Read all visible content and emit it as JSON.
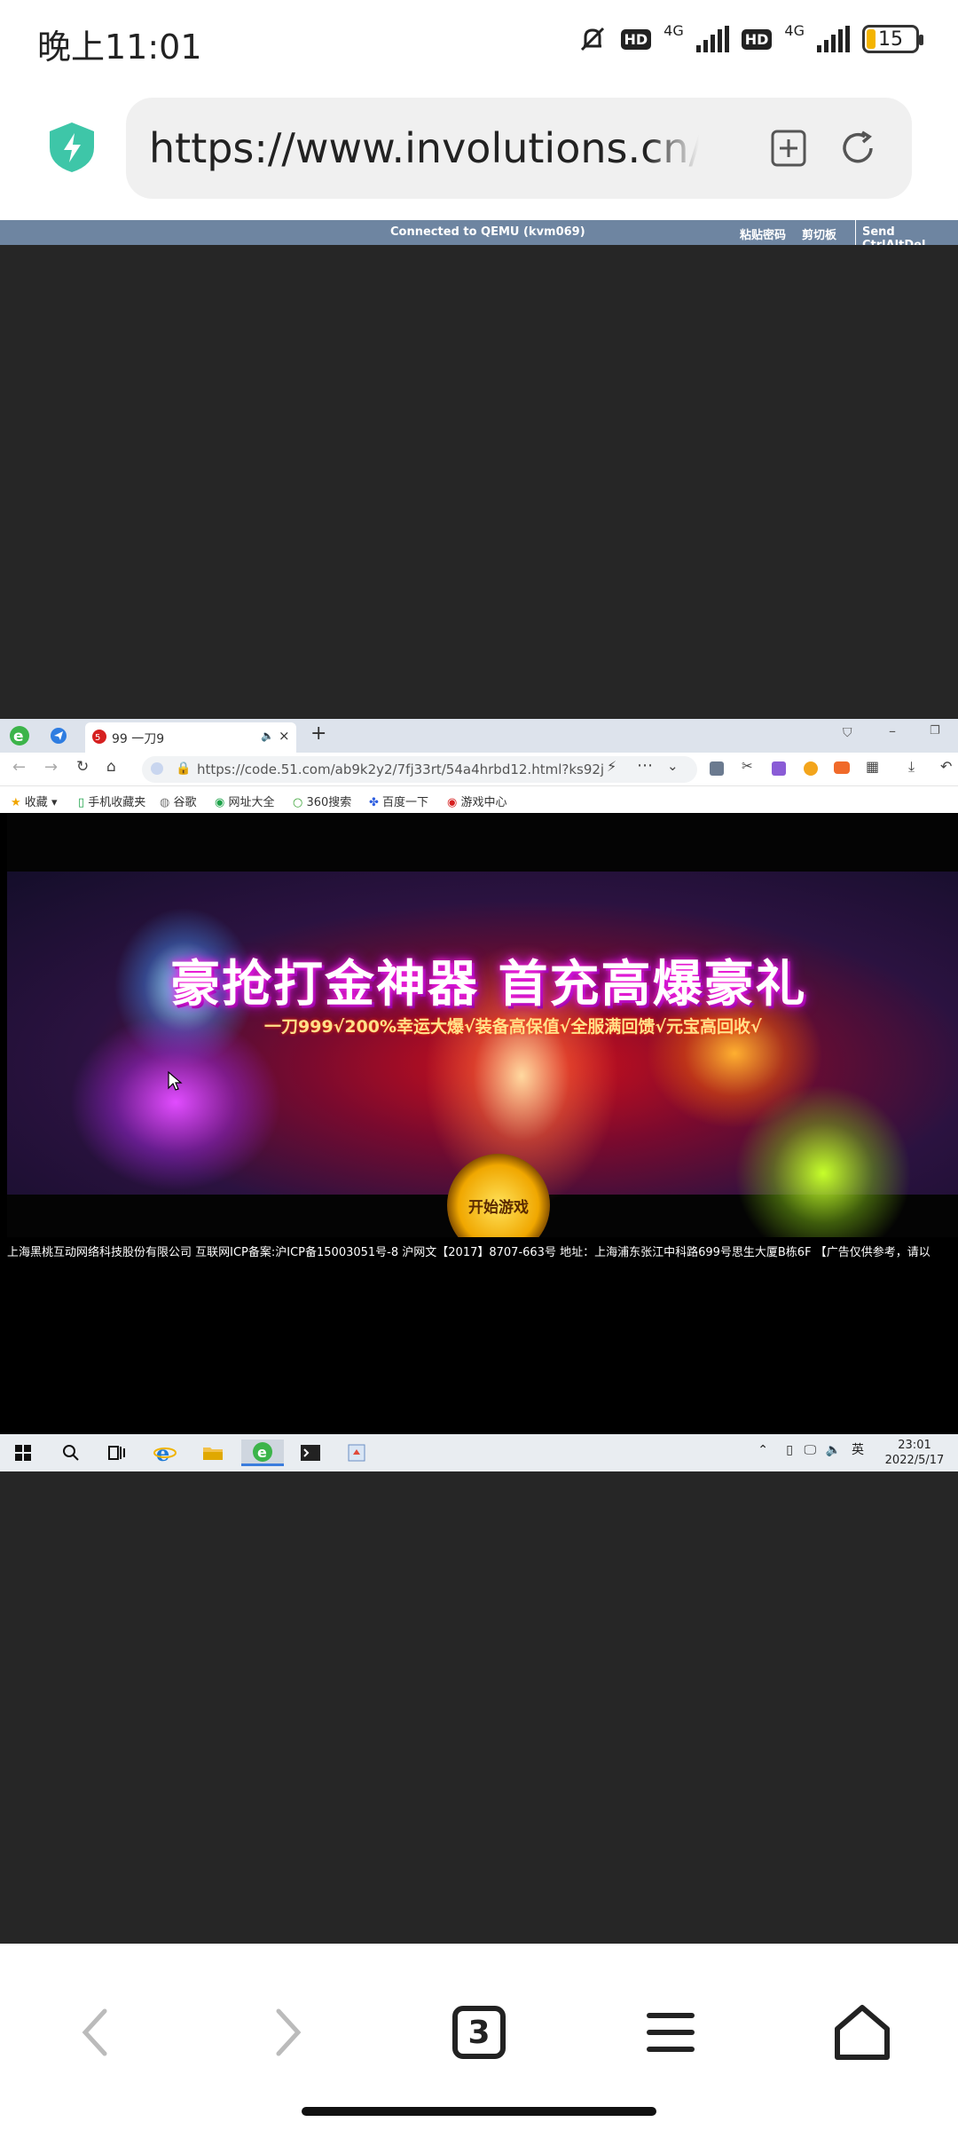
{
  "status_bar": {
    "time": "晚上11:01",
    "hd1": "HD",
    "net1": "4G",
    "hd2": "HD",
    "net2": "4G",
    "battery": "15"
  },
  "browser": {
    "url": "https://www.involutions.cn/d"
  },
  "qemu": {
    "title": "Connected to QEMU (kvm069)",
    "paste_password": "粘贴密码",
    "clipboard": "剪切板",
    "send_cad": "Send CtrlAltDel"
  },
  "remote": {
    "tab_title": "99 一刀9",
    "address": "https://code.51.com/ab9k2y2/7fj33rt/54a4hrbd12.html?ks92j",
    "favorites": [
      "收藏",
      "手机收藏夹",
      "谷歌",
      "网址大全",
      "360搜索",
      "百度一下",
      "游戏中心"
    ],
    "game": {
      "headline": "豪抢打金神器  首充高爆豪礼",
      "subline": "一刀999√200%幸运大爆√装备高保值√全服满回馈√元宝高回收√",
      "start_button": "开始游戏"
    },
    "footer": "上海黑桃互动网络科技股份有限公司   互联网ICP备案:沪ICP备15003051号-8   沪网文【2017】8707-663号   地址：上海浦东张江中科路699号思生大厦B栋6F   【广告仅供参考，请以",
    "tray": {
      "ime": "英",
      "time": "23:01",
      "date": "2022/5/17"
    }
  },
  "nav": {
    "tab_count": "3"
  },
  "colors": {
    "qemu_bar": "#6e85a1",
    "dark_bg": "#262626",
    "shield": "#3ec6a8"
  }
}
